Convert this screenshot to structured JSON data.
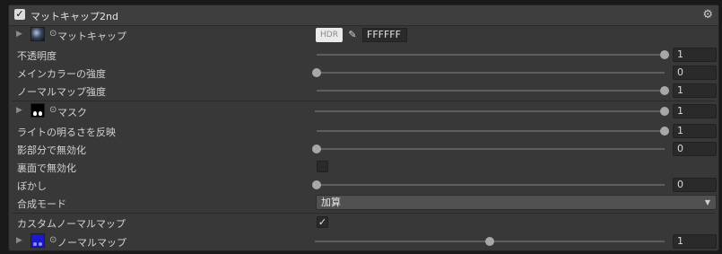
{
  "header": {
    "title": "マットキャップ2nd",
    "checked": true
  },
  "matcap": {
    "label": "マットキャップ",
    "hdr_label": "HDR",
    "color_hex": "FFFFFF"
  },
  "rows": {
    "opacity": {
      "label": "不透明度",
      "value": "1",
      "fraction": 1.0
    },
    "main_color_strength": {
      "label": "メインカラーの強度",
      "value": "0",
      "fraction": 0.0
    },
    "normal_map_strength": {
      "label": "ノーマルマップ強度",
      "value": "1",
      "fraction": 1.0
    },
    "mask": {
      "label": "マスク",
      "value": "1",
      "fraction": 1.0
    },
    "invert_light_brightness": {
      "label": "ライトの明るさを反映",
      "value": "1",
      "fraction": 1.0
    },
    "disable_in_shadow": {
      "label": "影部分で無効化",
      "value": "0",
      "fraction": 0.0
    },
    "disable_backface": {
      "label": "裏面で無効化",
      "checked": false
    },
    "blur": {
      "label": "ぼかし",
      "value": "0",
      "fraction": 0.0
    },
    "blend_mode": {
      "label": "合成モード",
      "selected": "加算"
    },
    "custom_normal_map": {
      "label": "カスタムノーマルマップ",
      "checked": true
    },
    "normal_map": {
      "label": "ノーマルマップ",
      "value": "1",
      "fraction": 0.5
    }
  },
  "colors": {
    "panel_bg": "#383838",
    "header_bg": "#3e3e3e",
    "accent": "#a8a8a8"
  }
}
